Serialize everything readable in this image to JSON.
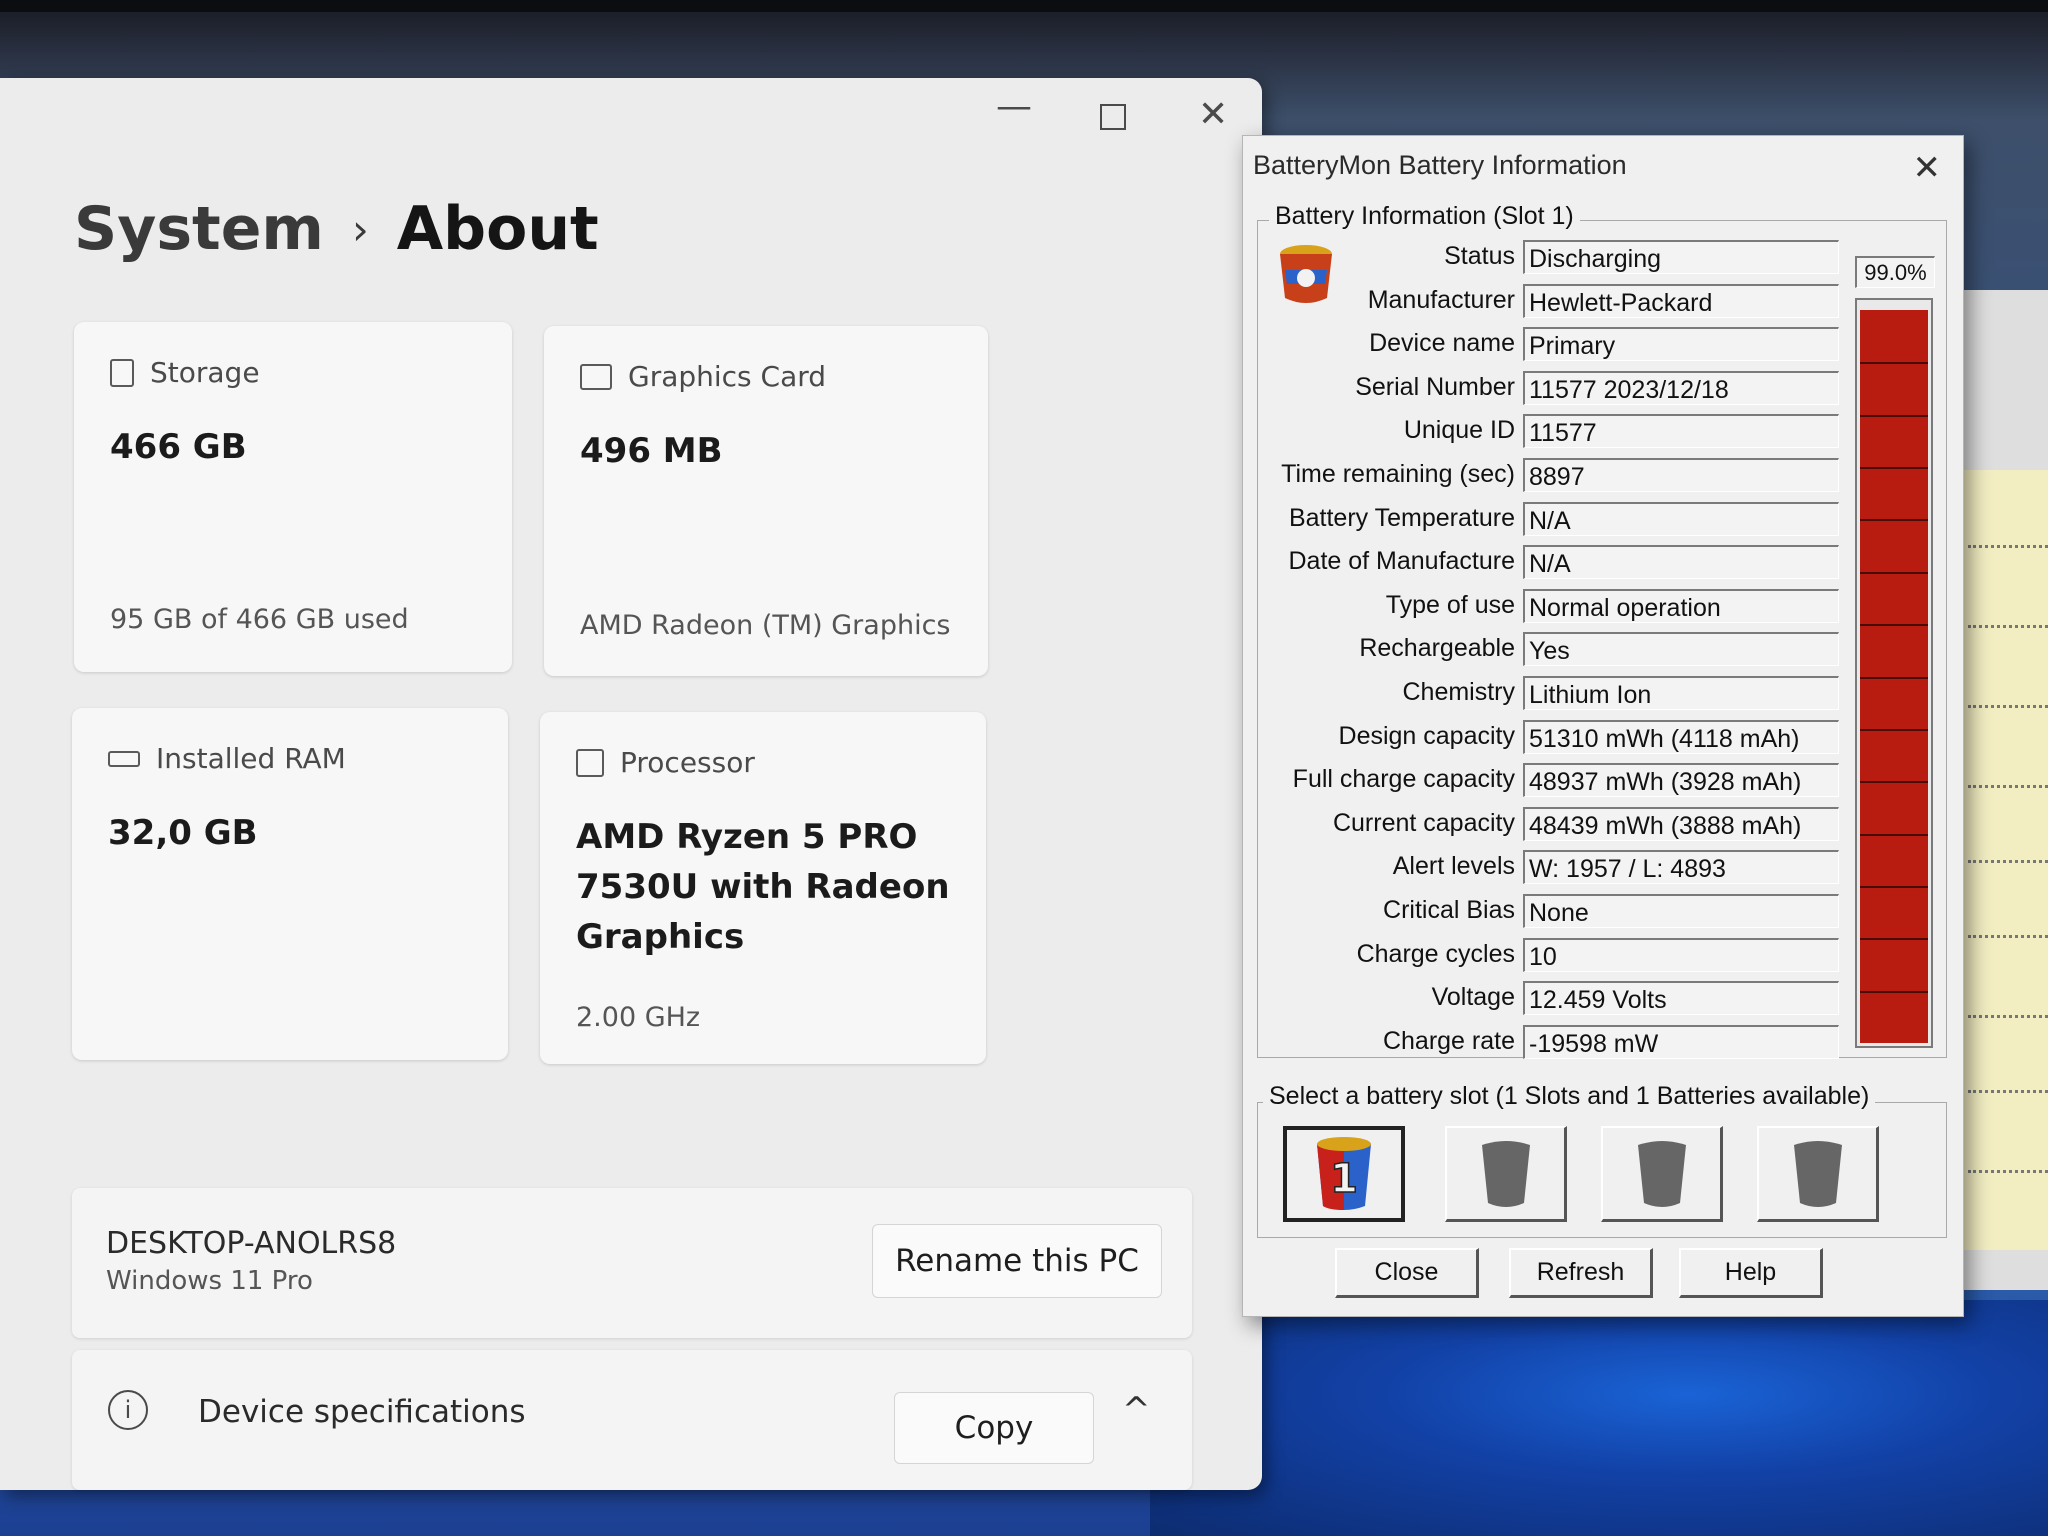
{
  "settings": {
    "breadcrumb": {
      "parent": "System",
      "separator": "›",
      "current": "About"
    },
    "window_controls": {
      "minimize": "—",
      "close": "✕"
    },
    "cards": {
      "storage": {
        "title": "Storage",
        "value": "466 GB",
        "sub": "95 GB of 466 GB used",
        "icon": "storage-icon"
      },
      "graphics": {
        "title": "Graphics Card",
        "value": "496 MB",
        "sub": "AMD Radeon (TM) Graphics",
        "icon": "graphics-card-icon"
      },
      "ram": {
        "title": "Installed RAM",
        "value": "32,0 GB",
        "icon": "ram-icon"
      },
      "processor": {
        "title": "Processor",
        "value_line1": "AMD Ryzen 5 PRO",
        "value_line2": "7530U with Radeon",
        "value_line3": "Graphics",
        "sub": "2.00 GHz",
        "icon": "processor-icon"
      }
    },
    "pc": {
      "name": "DESKTOP-ANOLRS8",
      "os": "Windows 11 Pro",
      "rename_label": "Rename this PC"
    },
    "specs": {
      "label": "Device specifications",
      "copy_label": "Copy",
      "info_glyph": "i",
      "chevron": "^"
    }
  },
  "batterymon": {
    "title": "BatteryMon Battery Information",
    "close_glyph": "✕",
    "group_label": "Battery Information (Slot 1)",
    "percent": "99.0%",
    "charge_fraction": 0.99,
    "meter_color": "#b81b10",
    "rows": [
      {
        "label": "Status",
        "value": "Discharging"
      },
      {
        "label": "Manufacturer",
        "value": "Hewlett-Packard"
      },
      {
        "label": "Device name",
        "value": "Primary"
      },
      {
        "label": "Serial Number",
        "value": "11577 2023/12/18"
      },
      {
        "label": "Unique ID",
        "value": "11577"
      },
      {
        "label": "Time remaining (sec)",
        "value": "8897"
      },
      {
        "label": "Battery Temperature",
        "value": "N/A"
      },
      {
        "label": "Date of Manufacture",
        "value": "N/A"
      },
      {
        "label": "Type of use",
        "value": "Normal operation"
      },
      {
        "label": "Rechargeable",
        "value": "Yes"
      },
      {
        "label": "Chemistry",
        "value": "Lithium Ion"
      },
      {
        "label": "Design capacity",
        "value": "51310 mWh (4118 mAh)"
      },
      {
        "label": "Full charge capacity",
        "value": "48937 mWh (3928 mAh)"
      },
      {
        "label": "Current capacity",
        "value": "48439 mWh (3888 mAh)"
      },
      {
        "label": "Alert levels",
        "value": "W: 1957 / L: 4893"
      },
      {
        "label": "Critical Bias",
        "value": "None"
      },
      {
        "label": "Charge cycles",
        "value": "10"
      },
      {
        "label": "Voltage",
        "value": "12.459 Volts"
      },
      {
        "label": "Charge rate",
        "value": "-19598 mW"
      }
    ],
    "slot_group_label": "Select a battery slot (1 Slots and 1 Batteries available)",
    "slot1_number": "1",
    "buttons": {
      "close": "Close",
      "refresh": "Refresh",
      "help": "Help"
    }
  }
}
